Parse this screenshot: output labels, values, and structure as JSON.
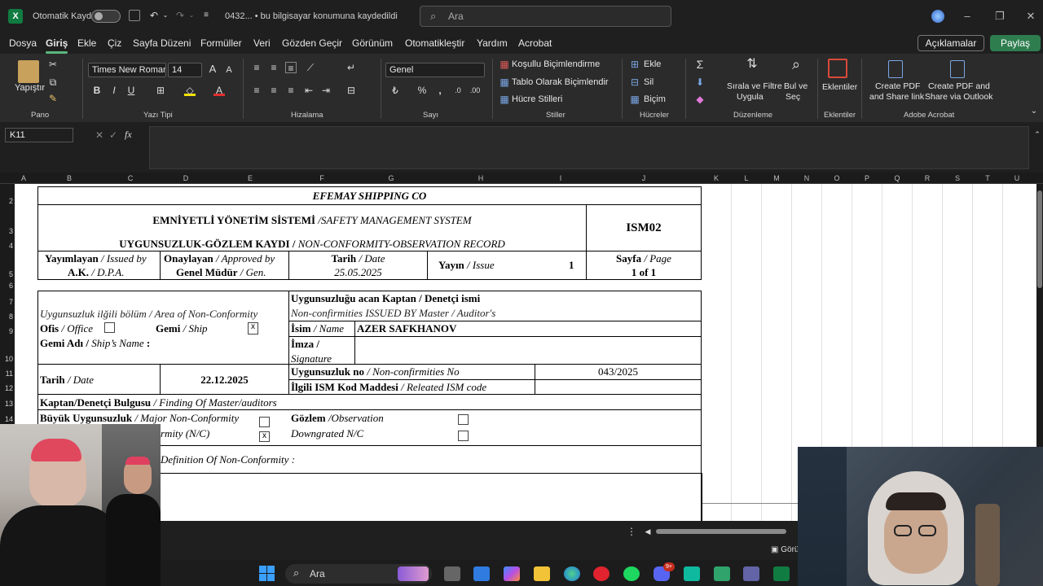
{
  "titlebar": {
    "autosave_label": "Otomatik Kaydet",
    "file_status": "0432... • bu bilgisayar konumuna kaydedildi",
    "search_placeholder": "Ara"
  },
  "menu": {
    "items": [
      "Dosya",
      "Giriş",
      "Ekle",
      "Çiz",
      "Sayfa Düzeni",
      "Formüller",
      "Veri",
      "Gözden Geçir",
      "Görünüm",
      "Otomatikleştir",
      "Yardım",
      "Acrobat"
    ],
    "active": "Giriş",
    "comments_label": "Açıklamalar",
    "share_label": "Paylaş"
  },
  "ribbon": {
    "paste_label": "Yapıştır",
    "group_clipboard": "Pano",
    "font_name": "Times New Roman",
    "font_size": "14",
    "group_font": "Yazı Tipi",
    "group_alignment": "Hizalama",
    "number_format": "Genel",
    "group_number": "Sayı",
    "conditional_label": "Koşullu Biçimlendirme",
    "table_label": "Tablo Olarak Biçimlendir",
    "cell_styles_label": "Hücre Stilleri",
    "group_styles": "Stiller",
    "insert_label": "Ekle",
    "delete_label": "Sil",
    "format_label": "Biçim",
    "group_cells": "Hücreler",
    "sort_label_1": "Sırala ve Filtre",
    "sort_label_2": "Uygula",
    "find_label_1": "Bul ve",
    "find_label_2": "Seç",
    "group_editing": "Düzenleme",
    "addins_label": "Eklentiler",
    "group_addins": "Eklentiler",
    "pdf_share_1": "Create PDF",
    "pdf_share_2": "and Share link",
    "pdf_outlook_1": "Create PDF and",
    "pdf_outlook_2": "Share via Outlook",
    "group_acrobat": "Adobe Acrobat"
  },
  "formula": {
    "name_box": "K11",
    "fx_label": "fx",
    "value": ""
  },
  "columns": [
    "A",
    "B",
    "C",
    "D",
    "E",
    "F",
    "G",
    "H",
    "I",
    "J",
    "K",
    "L",
    "M",
    "N",
    "O",
    "P",
    "Q",
    "R",
    "S",
    "T",
    "U"
  ],
  "rows": [
    "2",
    "3",
    "4",
    "5",
    "6",
    "7",
    "8",
    "9",
    "10",
    "11",
    "12",
    "13",
    "14"
  ],
  "sheet": {
    "company": "EFEMAY SHIPPING CO",
    "sms_tr": "EMNİYETLİ YÖNETİM SİSTEMİ ",
    "sms_en": "/SAFETY MANAGEMENT SYSTEM",
    "record_tr": "UYGUNSUZLUK-GÖZLEM KAYDI / ",
    "record_en": "NON-CONFORMITY-OBSERVATION RECORD",
    "doc_code": "ISM02",
    "issued_by_tr": "Yayımlayan",
    "issued_by_en": " / Issued by",
    "issued_by_val": "A.K.",
    "issued_by_val_en": " / D.P.A.",
    "approved_tr": "Onaylayan",
    "approved_en": " / Approved by",
    "approved_val": "Genel Müdür",
    "approved_val_en": " / Gen.",
    "date_tr": "Tarih",
    "date_en": " / Date",
    "date_val": "25.05.2025",
    "issue_tr": "Yayın",
    "issue_en": " / Issue",
    "issue_val": "1",
    "page_tr": "Sayfa",
    "page_en": " / Page",
    "page_val": "1 of 1",
    "area_label": "Uygunsuzluk ilğili bölüm / Area of Non-Conformity",
    "office_tr": "Ofis",
    "office_en": " / Office",
    "ship_tr": "Gemi",
    "ship_en": "  / Ship",
    "ship_check": "x",
    "ship_name_tr": "Gemi Adı /",
    "ship_name_en": " Ship’s Name",
    "ship_name_colon": " :",
    "issuer_title_tr": "Uygunsuzluğu acan Kaptan / Denetçi ismi",
    "issuer_title_en": "Non-confirmities ISSUED BY Master / Auditor's",
    "name_tr": "İsim",
    "name_en": " / Name",
    "name_val": "AZER SAFKHANOV",
    "sign_tr": "İmza /",
    "sign_en": "Signature",
    "date2_tr": "Tarih",
    "date2_en": " / Date",
    "date2_val": "22.12.2025",
    "nc_no_tr": "Uygunsuzluk no",
    "nc_no_en": " / Non-confirmities No",
    "nc_no_val": "043/2025",
    "ism_code_tr": "İlgili ISM Kod Maddesi",
    "ism_code_en": " / Releated ISM code",
    "finding_tr": "Kaptan/Denetçi Bulgusu",
    "finding_en": " / Finding Of Master/auditors",
    "major_tr": "Büyük Uygunsuzluk",
    "major_en": " / Major Non-Conformity",
    "minor_partial": "rmity (N/C)",
    "minor_check": "x",
    "obs_tr": "Gözlem",
    "obs_en": " /Observation",
    "downgraded": "Downgrated N/C",
    "definition": "Definition Of Non-Conformity :"
  },
  "statusbar": {
    "view_label": "Görü"
  },
  "taskbar": {
    "search_label": "Ara",
    "badge": "9+"
  }
}
